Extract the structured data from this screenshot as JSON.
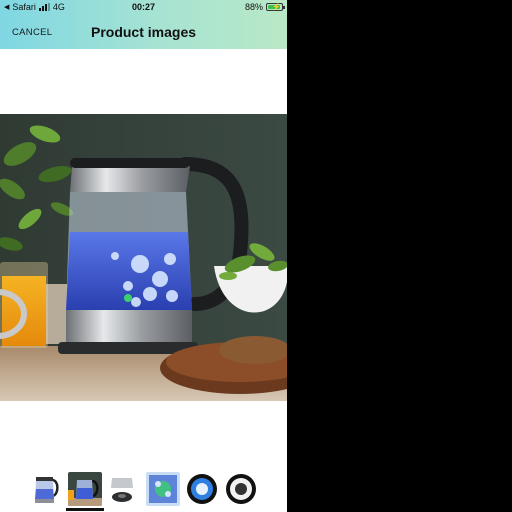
{
  "status": {
    "carrier": "Safari",
    "network": "4G",
    "time": "00:27",
    "battery": "88%",
    "battery_level": 0.88
  },
  "nav": {
    "cancel_label": "CANCEL",
    "title": "Product images"
  },
  "gallery": {
    "selected_index": 1,
    "thumbnails": [
      {
        "name": "kettle-front"
      },
      {
        "name": "kettle-kitchen-scene"
      },
      {
        "name": "kettle-base"
      },
      {
        "name": "kettle-water-closeup"
      },
      {
        "name": "feature-badge-blue"
      },
      {
        "name": "feature-badge-dark"
      }
    ]
  },
  "colors": {
    "header_gradient_start": "#7fd7e3",
    "header_gradient_end": "#b9e8c6",
    "water_glow": "#3d5bd6"
  }
}
